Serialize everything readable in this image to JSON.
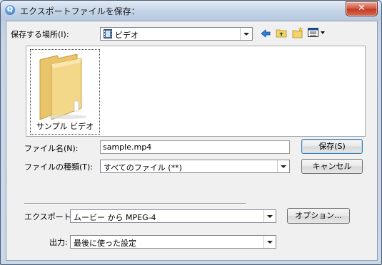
{
  "window": {
    "title": "エクスポートファイルを保存：",
    "close": "✕"
  },
  "location": {
    "label": "保存する場所(I):",
    "value": "ビデオ"
  },
  "toolbar_icons": [
    "back-arrow-icon",
    "up-folder-icon",
    "new-folder-icon",
    "view-menu-icon"
  ],
  "files": [
    {
      "name": "サンプル ビデオ"
    }
  ],
  "filename": {
    "label": "ファイル名(N):",
    "value": "sample.mp4"
  },
  "filetype": {
    "label": "ファイルの種類(T):",
    "value": "すべてのファイル (**)"
  },
  "buttons": {
    "save": "保存(S)",
    "cancel": "キャンセル",
    "options": "オプション..."
  },
  "export": {
    "label": "エクスポート:",
    "value": "ムービー から MPEG-4"
  },
  "output": {
    "label": "出力:",
    "value": "最後に使った設定"
  }
}
